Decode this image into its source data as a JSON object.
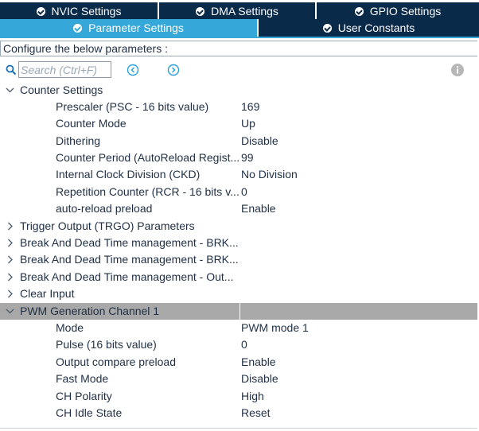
{
  "tabs_row1": [
    {
      "label": "NVIC Settings"
    },
    {
      "label": "DMA Settings"
    },
    {
      "label": "GPIO Settings"
    }
  ],
  "tabs_row2": [
    {
      "label": "Parameter Settings",
      "active": true
    },
    {
      "label": "User Constants",
      "active": false
    }
  ],
  "config_prompt": "Configure the below parameters :",
  "search": {
    "placeholder": "Search (Ctrl+F)"
  },
  "groups": {
    "counter_settings": {
      "label": "Counter Settings",
      "params": [
        {
          "name": "Prescaler (PSC - 16 bits value)",
          "value": "169"
        },
        {
          "name": "Counter Mode",
          "value": "Up"
        },
        {
          "name": "Dithering",
          "value": "Disable"
        },
        {
          "name": "Counter Period (AutoReload Regist...",
          "value": "99"
        },
        {
          "name": "Internal Clock Division (CKD)",
          "value": "No Division"
        },
        {
          "name": "Repetition Counter (RCR - 16 bits v...",
          "value": "0"
        },
        {
          "name": "auto-reload preload",
          "value": "Enable"
        }
      ]
    },
    "collapsed": [
      {
        "label": "Trigger Output (TRGO) Parameters"
      },
      {
        "label": "Break And Dead Time management - BRK..."
      },
      {
        "label": "Break And Dead Time management - BRK..."
      },
      {
        "label": "Break And Dead Time management - Out..."
      },
      {
        "label": "Clear Input"
      }
    ],
    "pwm_channel1": {
      "label": "PWM Generation Channel 1",
      "params": [
        {
          "name": "Mode",
          "value": "PWM mode 1"
        },
        {
          "name": "Pulse (16 bits value)",
          "value": "0"
        },
        {
          "name": "Output compare preload",
          "value": "Enable"
        },
        {
          "name": "Fast Mode",
          "value": "Disable"
        },
        {
          "name": "CH Polarity",
          "value": "High"
        },
        {
          "name": "CH Idle State",
          "value": "Reset"
        }
      ]
    }
  },
  "colors": {
    "tab_dark": "#0a2a4a",
    "tab_active": "#35a7d8",
    "selected_row": "#a8a8a8",
    "text": "#1f2f45"
  }
}
